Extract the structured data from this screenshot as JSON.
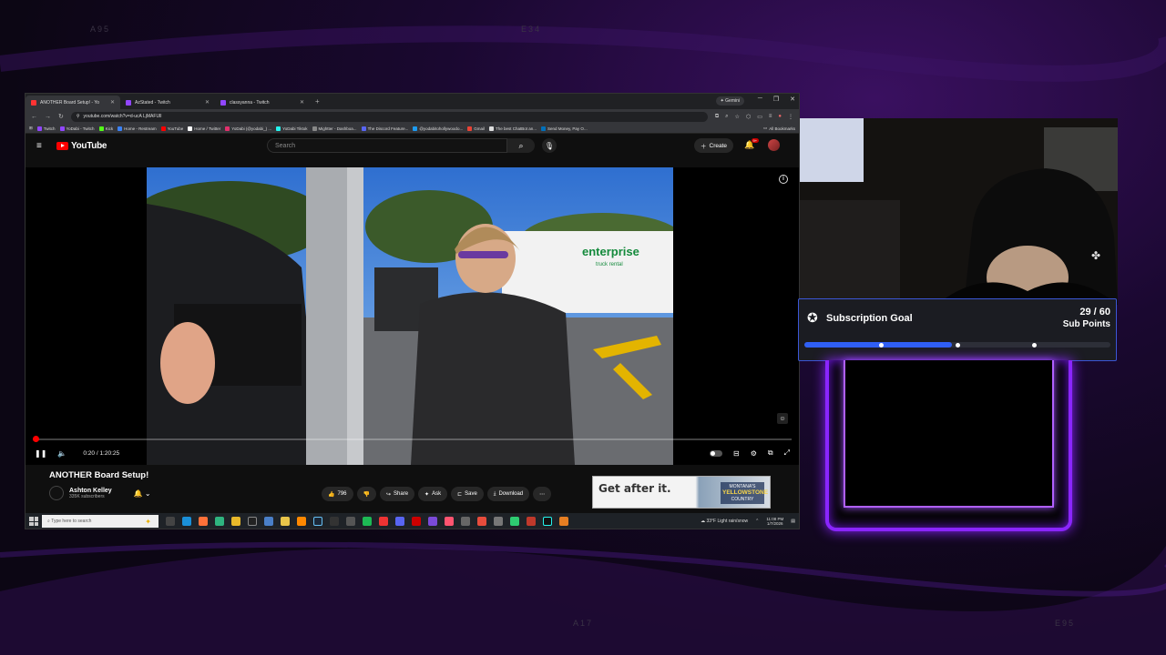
{
  "corner_codes": [
    "A95",
    "E34",
    "A17",
    "E95"
  ],
  "browser": {
    "tabs": [
      {
        "label": "ANOTHER Board Setup! - Yo",
        "active": true,
        "color": "#ff3333"
      },
      {
        "label": "AzStated - Twitch",
        "active": false,
        "color": "#9146ff"
      },
      {
        "label": "classyanna - Twitch",
        "active": false,
        "color": "#9146ff"
      }
    ],
    "gemini_label": "Gemini",
    "url": "youtube.com/watch?v=d-ucA LjMAFUlI",
    "bookmarks": [
      "Twitch",
      "YoDabi - Twitch",
      "Kick",
      "Home - Restream",
      "YouTube",
      "Home / Twitter",
      "YoDabi (@yodabi_) ...",
      "YoDabi Tiktok",
      "Mightter - Dashboa...",
      "The Discord Feature...",
      "@yodabitohollywoodo...",
      "Gmail",
      "The best ChatBot an...",
      "Send Money, Pay O..."
    ],
    "all_bookmarks": "All Bookmarks"
  },
  "youtube": {
    "logo_text": "YouTube",
    "search_placeholder": "Search",
    "create_label": "Create",
    "notif_count": "9+",
    "video": {
      "time_display": "0:20 / 1:20:25",
      "progress_fraction": 0.004,
      "title": "ANOTHER Board Setup!",
      "channel_name": "Ashton Kelley",
      "channel_subs": "335K subscribers",
      "likes": "796",
      "share_label": "Share",
      "ask_label": "Ask",
      "save_label": "Save",
      "download_label": "Download"
    },
    "ad": {
      "headline": "Get after it.",
      "brand_top": "MONTANA'S",
      "brand_main": "YELLOWSTONE",
      "brand_sub": "COUNTRY"
    }
  },
  "taskbar": {
    "search_placeholder": "Type here to search",
    "weather": "33°F  Light rain/snow",
    "time": "11:08 PM",
    "date": "1/7/2026"
  },
  "sub_goal": {
    "title": "Subscription Goal",
    "current": 29,
    "target": 60,
    "count_text": "29 / 60",
    "unit": "Sub Points",
    "milestones": [
      0.25,
      0.5,
      0.75
    ],
    "bar_color": "#2f5ff5"
  }
}
